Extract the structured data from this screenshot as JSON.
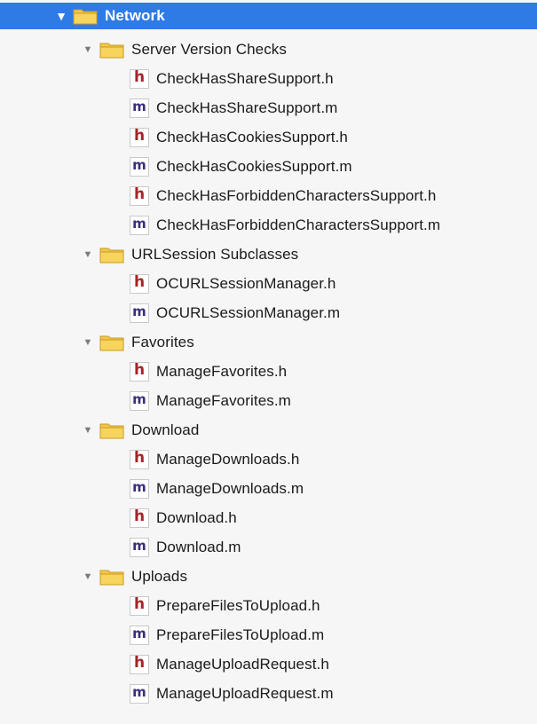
{
  "tree": {
    "root": {
      "label": "Network",
      "icon": "folder-icon",
      "expanded": true
    },
    "groups": [
      {
        "label": "Server Version Checks",
        "files": [
          {
            "kind": "h",
            "label": "CheckHasShareSupport.h"
          },
          {
            "kind": "m",
            "label": "CheckHasShareSupport.m"
          },
          {
            "kind": "h",
            "label": "CheckHasCookiesSupport.h"
          },
          {
            "kind": "m",
            "label": "CheckHasCookiesSupport.m"
          },
          {
            "kind": "h",
            "label": "CheckHasForbiddenCharactersSupport.h"
          },
          {
            "kind": "m",
            "label": "CheckHasForbiddenCharactersSupport.m"
          }
        ]
      },
      {
        "label": "URLSession Subclasses",
        "files": [
          {
            "kind": "h",
            "label": "OCURLSessionManager.h"
          },
          {
            "kind": "m",
            "label": "OCURLSessionManager.m"
          }
        ]
      },
      {
        "label": "Favorites",
        "files": [
          {
            "kind": "h",
            "label": "ManageFavorites.h"
          },
          {
            "kind": "m",
            "label": "ManageFavorites.m"
          }
        ]
      },
      {
        "label": "Download",
        "files": [
          {
            "kind": "h",
            "label": "ManageDownloads.h"
          },
          {
            "kind": "m",
            "label": "ManageDownloads.m"
          },
          {
            "kind": "h",
            "label": "Download.h"
          },
          {
            "kind": "m",
            "label": "Download.m"
          }
        ]
      },
      {
        "label": "Uploads",
        "files": [
          {
            "kind": "h",
            "label": "PrepareFilesToUpload.h"
          },
          {
            "kind": "m",
            "label": "PrepareFilesToUpload.m"
          },
          {
            "kind": "h",
            "label": "ManageUploadRequest.h"
          },
          {
            "kind": "m",
            "label": "ManageUploadRequest.m"
          }
        ]
      }
    ]
  },
  "colors": {
    "selection": "#2f7be6",
    "folder": "#f2c84b",
    "header_glyph": "#a3252a",
    "impl_glyph": "#3c2d7e"
  }
}
